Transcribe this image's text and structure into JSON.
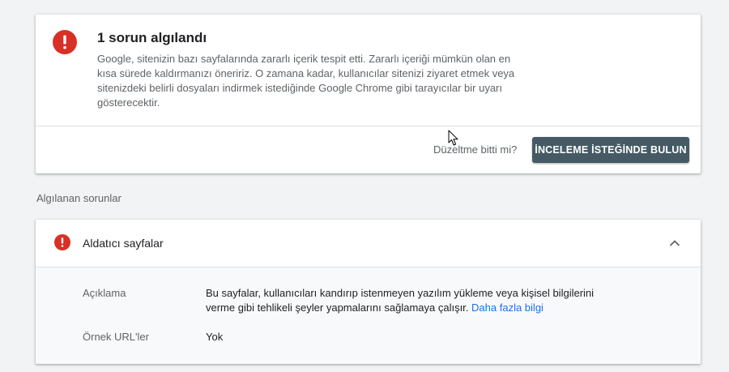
{
  "summary": {
    "title": "1 sorun algılandı",
    "description": "Google, sitenizin bazı sayfalarında zararlı içerik tespit etti. Zararlı içeriği mümkün olan en kısa sürede kaldırmanızı öneririz. O zamana kadar, kullanıcılar sitenizi ziyaret etmek veya sitenizdeki belirli dosyaları indirmek istediğinde Google Chrome gibi tarayıcılar bir uyarı gösterecektir.",
    "fixed_question": "Düzeltme bitti mi?",
    "review_button_label": "İNCELEME İSTEĞİNDE BULUN"
  },
  "detected_issues": {
    "heading": "Algılanan sorunlar",
    "items": [
      {
        "title": "Aldatıcı sayfalar",
        "expanded": true,
        "description_label": "Açıklama",
        "description_text": "Bu sayfalar, kullanıcıları kandırıp istenmeyen yazılım yükleme veya kişisel bilgilerini verme gibi tehlikeli şeyler yapmalarını sağlamaya çalışır.",
        "learn_more_label": "Daha fazla bilgi",
        "sample_urls_label": "Örnek URL'ler",
        "sample_urls_value": "Yok"
      }
    ]
  },
  "icons": {
    "alert": "exclamation-circle-icon",
    "chevron": "chevron-up-icon",
    "cursor": "mouse-pointer-icon"
  },
  "colors": {
    "alert_red": "#d93025",
    "button_bg": "#455a64",
    "link_blue": "#1a73e8",
    "page_bg": "#f1f3f4"
  }
}
